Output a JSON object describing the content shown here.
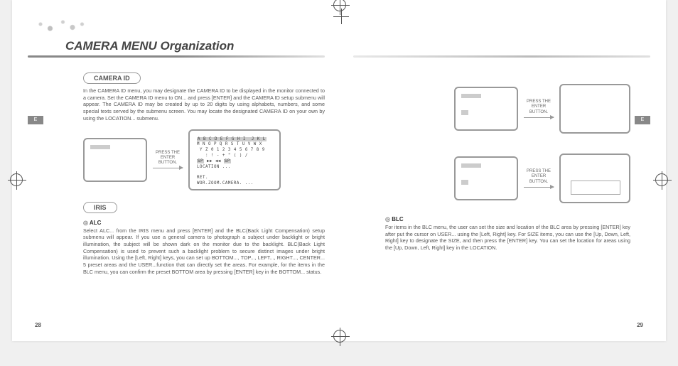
{
  "header": {
    "title": "CAMERA MENU Organization"
  },
  "side_tabs": {
    "left": "E",
    "right": "E"
  },
  "page_numbers": {
    "left": "28",
    "right": "29"
  },
  "arrows": {
    "label": "PRESS THE\nENTER\nBUTTON."
  },
  "sections": {
    "camera_id": {
      "label": "CAMERA ID",
      "body": "In the CAMERA ID menu, you may designate the CAMERA ID to be displayed in the monitor connected to a camera. Set the CAMERA ID menu to ON... and press [ENTER] and the CAMERA ID setup submenu will appear. The CAMERA ID may be created by up to 20 digits by using alphabets, numbers, and some special texts served by the submenu screen. You may locate the designated CAMERA ID on your own by using the LOCATION... submenu."
    },
    "iris": {
      "label": "IRIS",
      "alc_label": "ALC",
      "alc_body": "Select ALC... from the IRIS menu and press [ENTER] and the BLC(Back Light Compensation) setup submenu will appear. If you use a general camera to photograph a subject under backlight or bright illumination, the subject will be shown dark on the monitor due to the backlight. BLC(Back Light Compensation) is used to prevent such a backlight problem to secure distinct images under bright illumination. Using the [Left, Right] keys, you can set up BOTTOM..., TOP..., LEFT..., RIGHT..., CENTER... 5 preset areas and the USER...function that can directly set the areas. For example, for the items in the BLC menu, you can confirm the preset BOTTOM area by pressing [ENTER] key in the BOTTOM... status."
    },
    "blc": {
      "blc_label": "BLC",
      "blc_body": "For items in the BLC menu, the user can set the size and location of the BLC area by pressing [ENTER] key after put the cursor on USER... using the [Left, Right] key. For SIZE items, you can use the [Up, Down, Left, Right] key to designate the SIZE, and then press the [ENTER] key. You can set the location for areas using the [Up, Down, Left, Right] key in the LOCATION."
    }
  },
  "char_screen": {
    "row1": "A B C D E F G H I  J K L",
    "row2": "M N O P Q R S T U V W X",
    "row3": " Y Z 0 1 2 3 4 5 6 7 8 9",
    "row4": "   : ! - + \" ( ) /",
    "row5_a": "SP",
    "row5_b": "SP",
    "row6": "LOCATION ...",
    "row7": "RET.",
    "row8": "WOR.ZOOM.CAMERA. ..."
  }
}
